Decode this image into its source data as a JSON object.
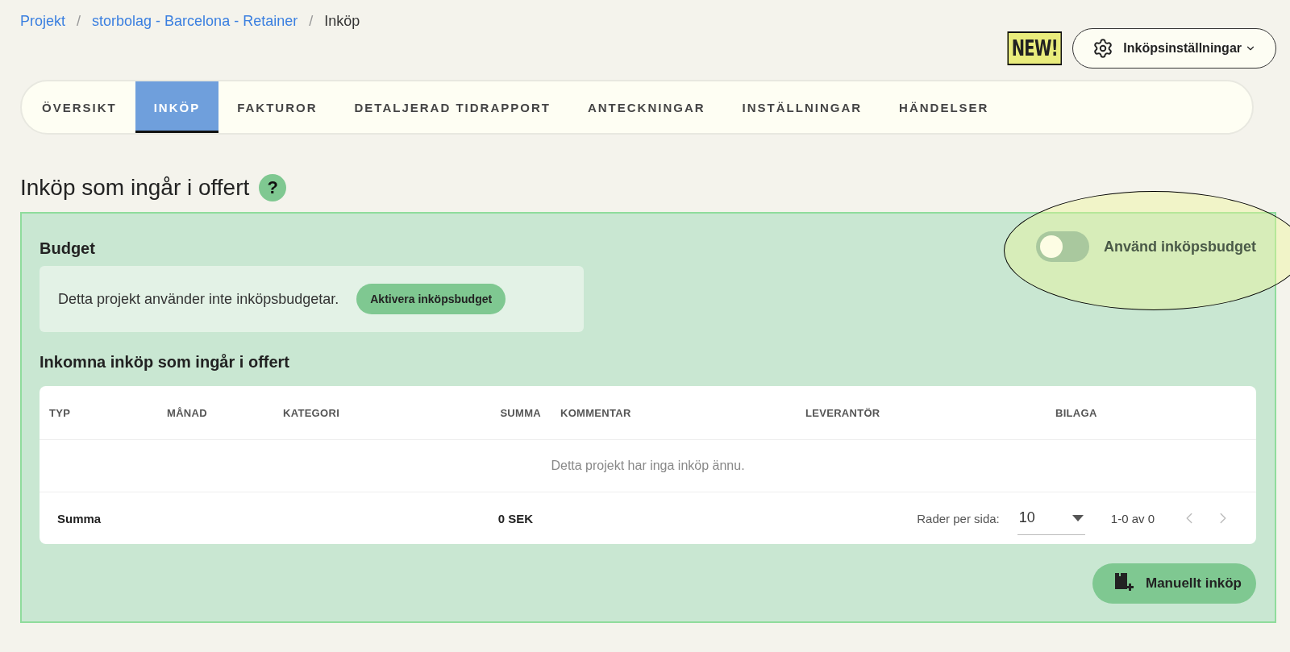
{
  "breadcrumb": [
    {
      "label": "Projekt",
      "kind": "link"
    },
    {
      "label": "storbolag - Barcelona - Retainer",
      "kind": "link"
    },
    {
      "label": "Inköp",
      "kind": "current"
    }
  ],
  "breadcrumb_separator": "/",
  "new_badge": "NEW!",
  "settings_button": {
    "label": "Inköpsinställningar"
  },
  "tabs": [
    {
      "label": "ÖVERSIKT",
      "selected": false
    },
    {
      "label": "INKÖP",
      "selected": true
    },
    {
      "label": "FAKTUROR",
      "selected": false
    },
    {
      "label": "DETALJERAD TIDRAPPORT",
      "selected": false
    },
    {
      "label": "ANTECKNINGAR",
      "selected": false
    },
    {
      "label": "INSTÄLLNINGAR",
      "selected": false
    },
    {
      "label": "HÄNDELSER",
      "selected": false
    }
  ],
  "section_title": "Inköp som ingår i offert",
  "help_icon": "?",
  "budget": {
    "title": "Budget",
    "message": "Detta projekt använder inte inköpsbudgetar.",
    "activate_button": "Aktivera inköpsbudget"
  },
  "budget_toggle": {
    "label": "Använd inköpsbudget",
    "on": false
  },
  "purchases_title": "Inkomna inköp som ingår i offert",
  "table": {
    "columns": [
      {
        "label": "TYP",
        "kind": "text"
      },
      {
        "label": "MÅNAD",
        "kind": "text"
      },
      {
        "label": "KATEGORI",
        "kind": "text"
      },
      {
        "label": "SUMMA",
        "kind": "amount"
      },
      {
        "label": "KOMMENTAR",
        "kind": "text"
      },
      {
        "label": "LEVERANTÖR",
        "kind": "text"
      },
      {
        "label": "BILAGA",
        "kind": "text"
      }
    ],
    "empty_message": "Detta projekt har inga inköp ännu.",
    "footer": {
      "label": "Summa",
      "sum": "0 SEK",
      "rows_per_page_label": "Rader per sida:",
      "rows_per_page": "10",
      "range": "1-0 av 0"
    }
  },
  "manual_button": "Manuellt inköp"
}
